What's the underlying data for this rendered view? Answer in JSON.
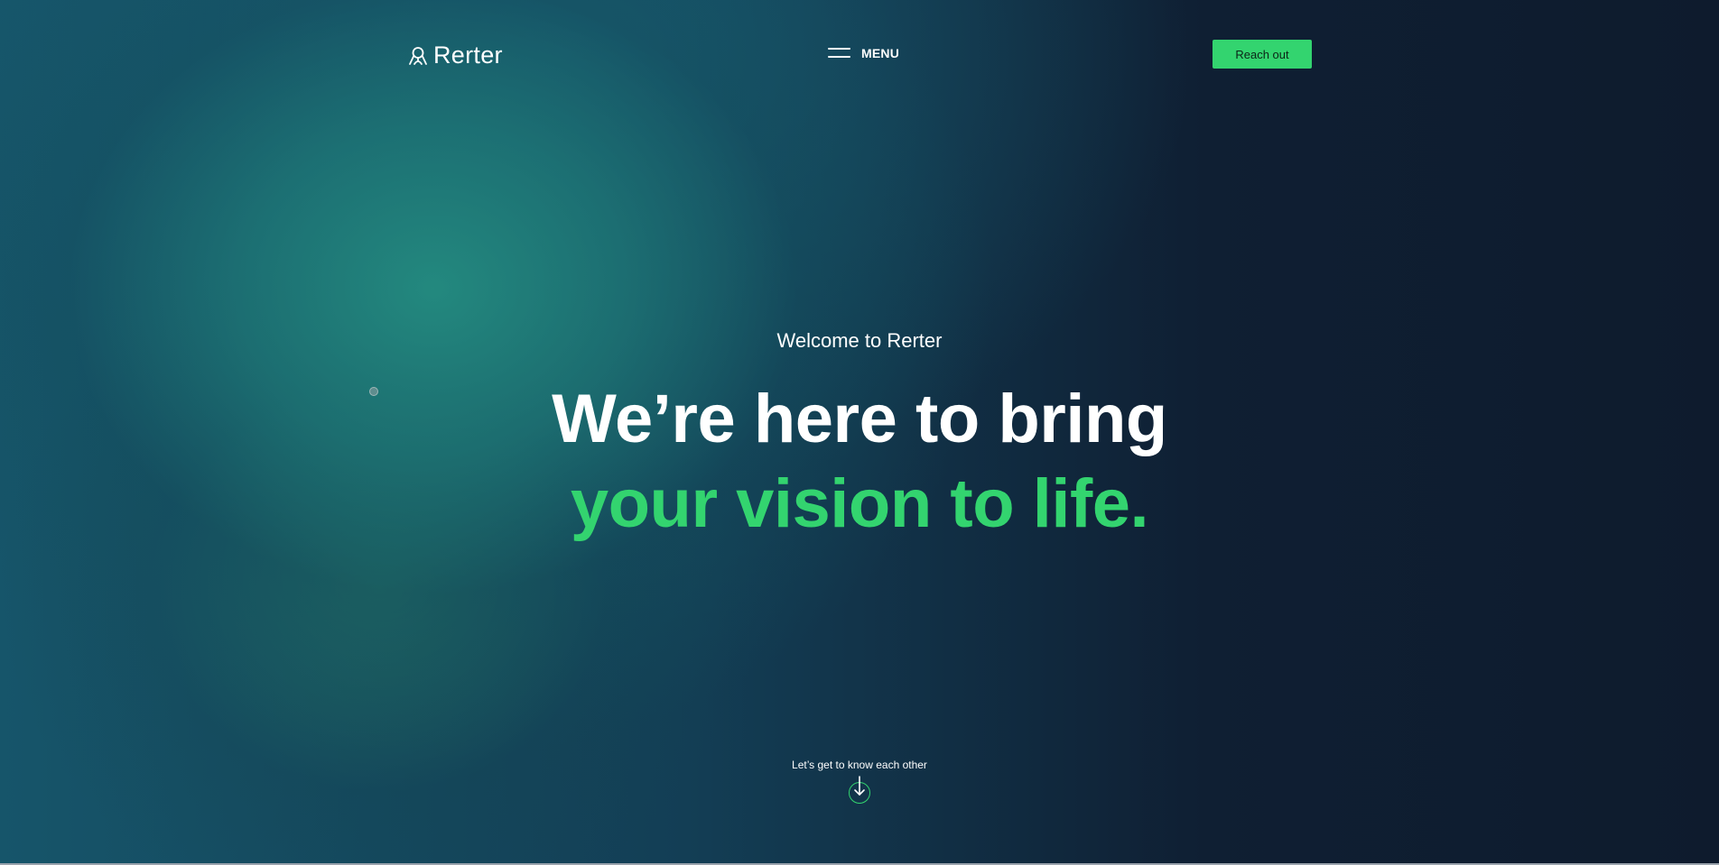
{
  "brand": {
    "name": "Rerter",
    "logo_icon": "rerter-mark-icon"
  },
  "header": {
    "menu_label": "MENU",
    "menu_icon": "hamburger-icon",
    "cta_label": "Reach out"
  },
  "hero": {
    "eyebrow": "Welcome to Rerter",
    "headline_line1": "We’re here to bring",
    "headline_line2": "your vision to life."
  },
  "scroll_cue": {
    "label": "Let’s get to know each other",
    "icon": "arrow-down-circle-icon"
  },
  "colors": {
    "accent": "#33d46f",
    "background_dark": "#0f1d2e",
    "background_teal": "#1f8580",
    "text": "#ffffff"
  }
}
